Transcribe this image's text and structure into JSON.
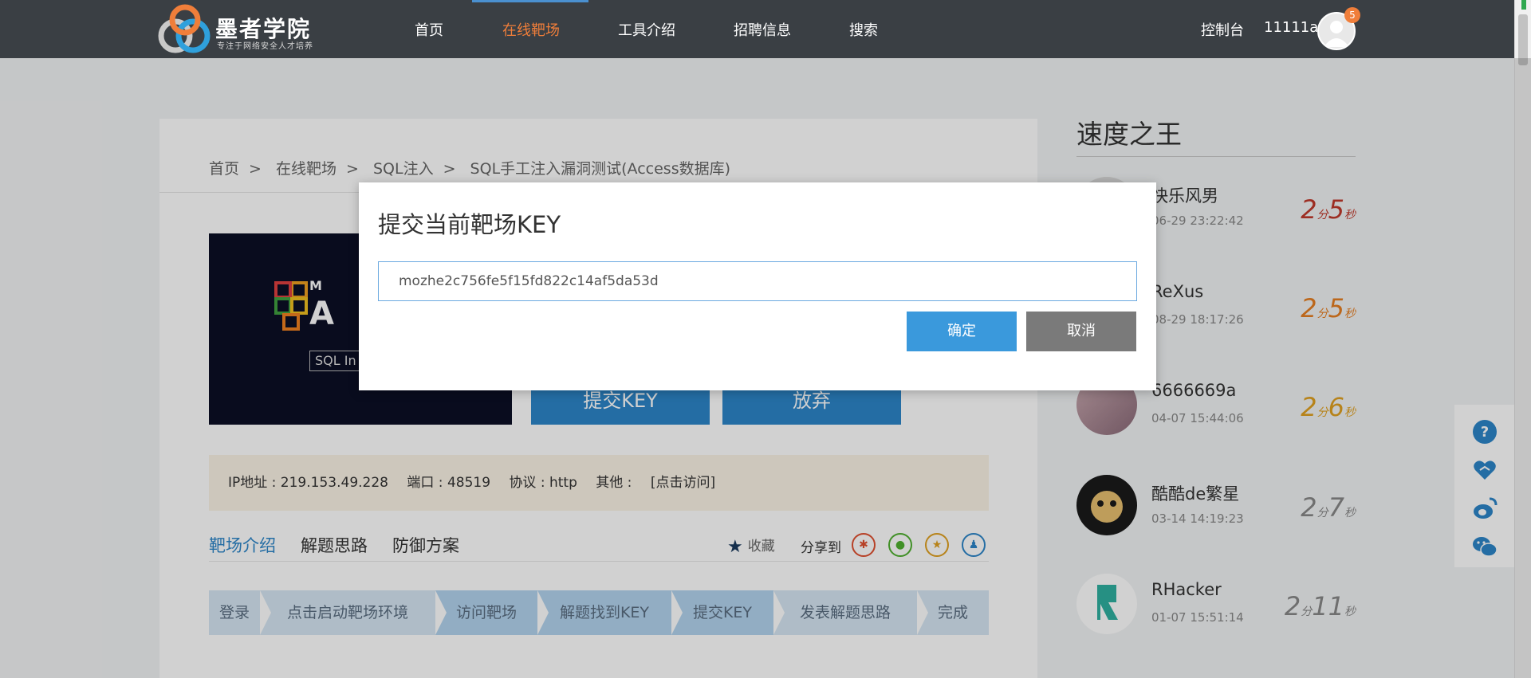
{
  "brand": {
    "title": "墨者学院",
    "subtitle": "专注于网络安全人才培养"
  },
  "nav": {
    "items": [
      {
        "label": "首页"
      },
      {
        "label": "在线靶场",
        "active": true
      },
      {
        "label": "工具介绍"
      },
      {
        "label": "招聘信息"
      },
      {
        "label": "搜索"
      }
    ],
    "console": "控制台",
    "username": "11111a",
    "badge": "5",
    "active_color": "#f07e3a"
  },
  "breadcrumb": {
    "items": [
      "首页",
      "在线靶场",
      "SQL注入",
      "SQL手工注入漏洞测试(Access数据库)"
    ],
    "separator": ">"
  },
  "cover": {
    "text_visible": "M\nA",
    "tag": "SQL In"
  },
  "actions": {
    "submit_key": "提交KEY",
    "abandon": "放弃"
  },
  "connection": {
    "ip": "IP地址 : 219.153.49.228",
    "port": "端口 : 48519",
    "protocol": "协议 : http",
    "other": "其他 :",
    "visit": "[点击访问]"
  },
  "tabs": {
    "items": [
      "靶场介绍",
      "解题思路",
      "防御方案"
    ],
    "favorite": "收藏",
    "share_label": "分享到",
    "share_icons": [
      "weibo-icon",
      "wechat-icon",
      "qzone-icon",
      "qq-icon"
    ]
  },
  "steps": [
    "登录",
    "点击启动靶场环境",
    "访问靶场",
    "解题找到KEY",
    "提交KEY",
    "发表解题思路",
    "完成"
  ],
  "leaderboard": {
    "title": "速度之王",
    "entries": [
      {
        "name": "快乐风男",
        "time": "06-29 23:22:42",
        "min": "2",
        "min_unit": "分",
        "sec": "5",
        "sec_unit": "秒",
        "color": "#c0392b"
      },
      {
        "name": "ReXus",
        "time": "08-29 18:17:26",
        "min": "2",
        "min_unit": "分",
        "sec": "5",
        "sec_unit": "秒",
        "color": "#e67e22"
      },
      {
        "name": "6666669a",
        "time": "04-07 15:44:06",
        "min": "2",
        "min_unit": "分",
        "sec": "6",
        "sec_unit": "秒",
        "color": "#e0a020"
      },
      {
        "name": "酷酷de繁星",
        "time": "03-14 14:19:23",
        "min": "2",
        "min_unit": "分",
        "sec": "7",
        "sec_unit": "秒",
        "color": "#888888"
      },
      {
        "name": "RHacker",
        "time": "01-07 15:51:14",
        "min": "2",
        "min_unit": "分",
        "sec": "11",
        "sec_unit": "秒",
        "color": "#888888"
      }
    ]
  },
  "float_panel": {
    "icons": [
      "help-icon",
      "handshake-icon",
      "weibo-icon",
      "wechat-icon"
    ],
    "color": "#2d85c8"
  },
  "modal": {
    "title": "提交当前靶场KEY",
    "key_value": "mozhe2c756fe5f15fd822c14af5da53d",
    "confirm": "确定",
    "cancel": "取消"
  }
}
